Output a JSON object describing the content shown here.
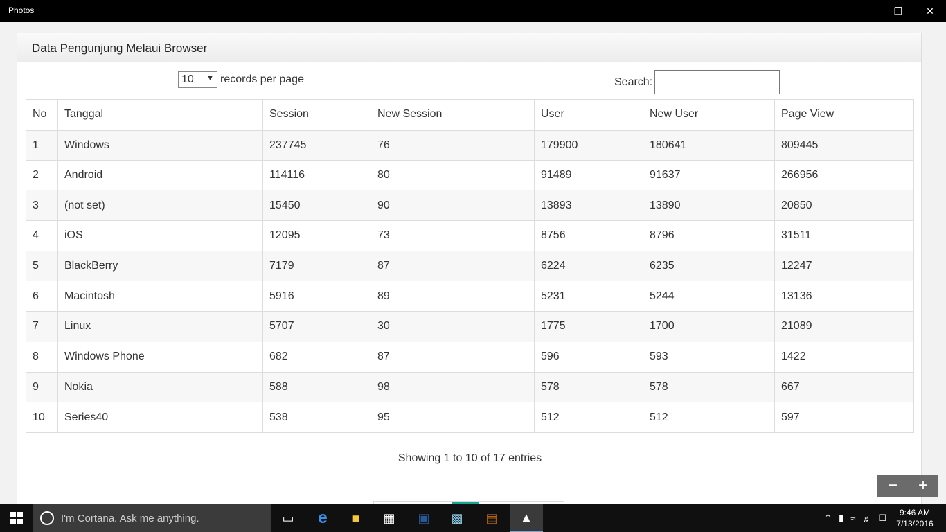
{
  "window": {
    "title": "Photos"
  },
  "panel": {
    "heading": "Data Pengunjung Melaui Browser"
  },
  "length_control": {
    "value": "10",
    "suffix": "records per page"
  },
  "search": {
    "label": "Search:"
  },
  "table": {
    "headers": [
      "No",
      "Tanggal",
      "Session",
      "New Session",
      "User",
      "New User",
      "Page View"
    ],
    "rows": [
      [
        "1",
        "Windows",
        "237745",
        "76",
        "179900",
        "180641",
        "809445"
      ],
      [
        "2",
        "Android",
        "114116",
        "80",
        "91489",
        "91637",
        "266956"
      ],
      [
        "3",
        "(not set)",
        "15450",
        "90",
        "13893",
        "13890",
        "20850"
      ],
      [
        "4",
        "iOS",
        "12095",
        "73",
        "8756",
        "8796",
        "31511"
      ],
      [
        "5",
        "BlackBerry",
        "7179",
        "87",
        "6224",
        "6235",
        "12247"
      ],
      [
        "6",
        "Macintosh",
        "5916",
        "89",
        "5231",
        "5244",
        "13136"
      ],
      [
        "7",
        "Linux",
        "5707",
        "30",
        "1775",
        "1700",
        "21089"
      ],
      [
        "8",
        "Windows Phone",
        "682",
        "87",
        "596",
        "593",
        "1422"
      ],
      [
        "9",
        "Nokia",
        "588",
        "98",
        "578",
        "578",
        "667"
      ],
      [
        "10",
        "Series40",
        "538",
        "95",
        "512",
        "512",
        "597"
      ]
    ]
  },
  "info": "Showing 1 to 10 of 17 entries",
  "taskbar": {
    "cortana_placeholder": "I'm Cortana. Ask me anything.",
    "time": "9:46 AM",
    "date": "7/13/2016"
  },
  "colors": {
    "accent": "#17a58f",
    "titlebar": "#000000",
    "taskbar": "#101010"
  }
}
